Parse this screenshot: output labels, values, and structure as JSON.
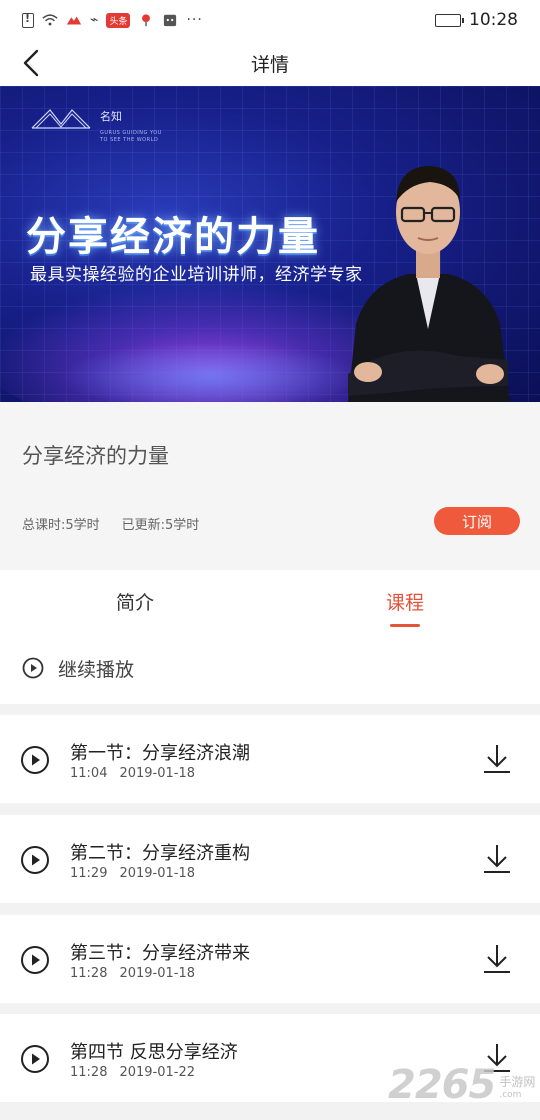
{
  "status_bar": {
    "badge": "头条",
    "time": "10:28"
  },
  "nav": {
    "title": "详情"
  },
  "banner": {
    "brand_name": "名知",
    "brand_tagline": "GURUS GUIDING YOU TO SEE THE WORLD",
    "headline": "分享经济的力量",
    "subheadline": "最具实操经验的企业培训讲师，经济学专家"
  },
  "course": {
    "title": "分享经济的力量",
    "total_hours": "总课时:5学时",
    "updated": "已更新:5学时",
    "subscribe_label": "订阅"
  },
  "tabs": {
    "intro": "简介",
    "course": "课程"
  },
  "continue": {
    "label": "继续播放"
  },
  "lessons": [
    {
      "title": "第一节：分享经济浪潮",
      "duration": "11:04",
      "date": "2019-01-18"
    },
    {
      "title": "第二节：分享经济重构",
      "duration": "11:29",
      "date": "2019-01-18"
    },
    {
      "title": "第三节：分享经济带来",
      "duration": "11:28",
      "date": "2019-01-18"
    },
    {
      "title": "第四节 反思分享经济",
      "duration": "11:28",
      "date": "2019-01-22"
    }
  ],
  "watermark": {
    "number": "2265",
    "site_cn": "手游网",
    "url": ".com"
  },
  "colors": {
    "accent": "#e5533a",
    "subscribe_bg": "#ef5a3c",
    "banner_dark": "#0b0f55"
  }
}
